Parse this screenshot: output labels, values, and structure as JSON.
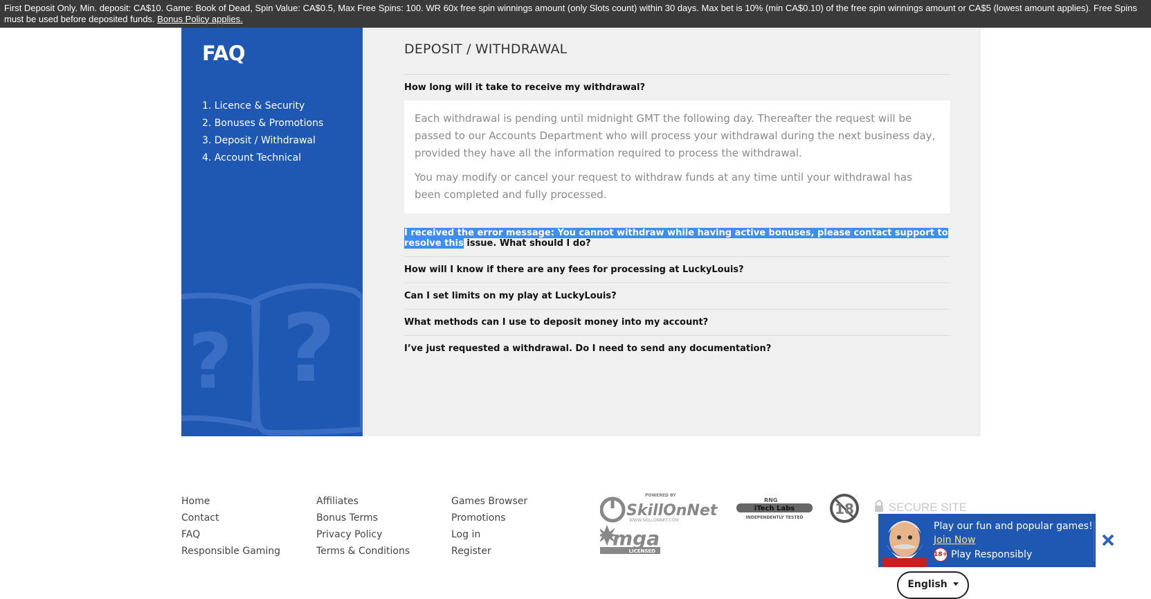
{
  "promo": {
    "text": "First Deposit Only. Min. deposit: CA$10. Game: Book of Dead, Spin Value: CA$0.5, Max Free Spins: 100. WR 60x free spin winnings amount (only Slots count) within 30 days. Max bet is 10% (min CA$0.10) of the free spin winnings amount or CA$5 (lowest amount applies). Free Spins must be used before deposited funds.",
    "link": "Bonus Policy applies."
  },
  "sidebar": {
    "title": "FAQ",
    "items": [
      {
        "label": "1. Licence & Security"
      },
      {
        "label": "2. Bonuses & Promotions"
      },
      {
        "label": "3. Deposit / Withdrawal"
      },
      {
        "label": "4. Account Technical"
      }
    ]
  },
  "main": {
    "section_title": "DEPOSIT / WITHDRAWAL",
    "questions": [
      {
        "q": "How long will it take to receive my withdrawal?"
      },
      {
        "q_highlight": "I received the error message: You cannot withdraw while having active bonuses, please contact support to resolve this",
        "q_rest": "issue. What should I do?"
      },
      {
        "q": "How will I know if there are any fees for processing at LuckyLouis?"
      },
      {
        "q": "Can I set limits on my play at LuckyLouis?"
      },
      {
        "q": "What methods can I use to deposit money into my account?"
      },
      {
        "q": "I’ve just requested a withdrawal. Do I need to send any documentation?"
      }
    ],
    "answer": {
      "p1": "Each withdrawal is pending until midnight GMT the following day. Thereafter the request will be passed to our Accounts Department who will process your withdrawal during the next business day, provided they have all the information required to process the withdrawal.",
      "p2": "You may modify or cancel your request to withdraw funds at any time until your withdrawal has been completed and fully processed."
    }
  },
  "footer": {
    "col1": [
      "Home",
      "Contact",
      "FAQ",
      "Responsible Gaming"
    ],
    "col2": [
      "Affiliates",
      "Bonus Terms",
      "Privacy Policy",
      "Terms & Conditions"
    ],
    "col3": [
      "Games Browser",
      "Promotions",
      "Log in",
      "Register"
    ]
  },
  "logos": {
    "skillonnet_powered": "POWERED BY",
    "skillonnet": "SkillOnNet",
    "skillonnet_url": "WWW.SKILLONNET.COM",
    "rng": "RNG",
    "itech": "iTech Labs",
    "itech_sub": "INDEPENDENTLY TESTED",
    "age": "18",
    "mga": "mga",
    "mga_sub": "LICENSED",
    "secure": "SECURE SITE"
  },
  "popup": {
    "message": "Play our fun and popular games!",
    "join": "Join Now",
    "responsible": "Play Responsibly",
    "badge": "18+"
  },
  "language": {
    "label": "English"
  },
  "colors": {
    "brand_blue": "#1f58b3",
    "highlight": "#3d8ef0",
    "promo_bg": "#3a3a3a"
  }
}
